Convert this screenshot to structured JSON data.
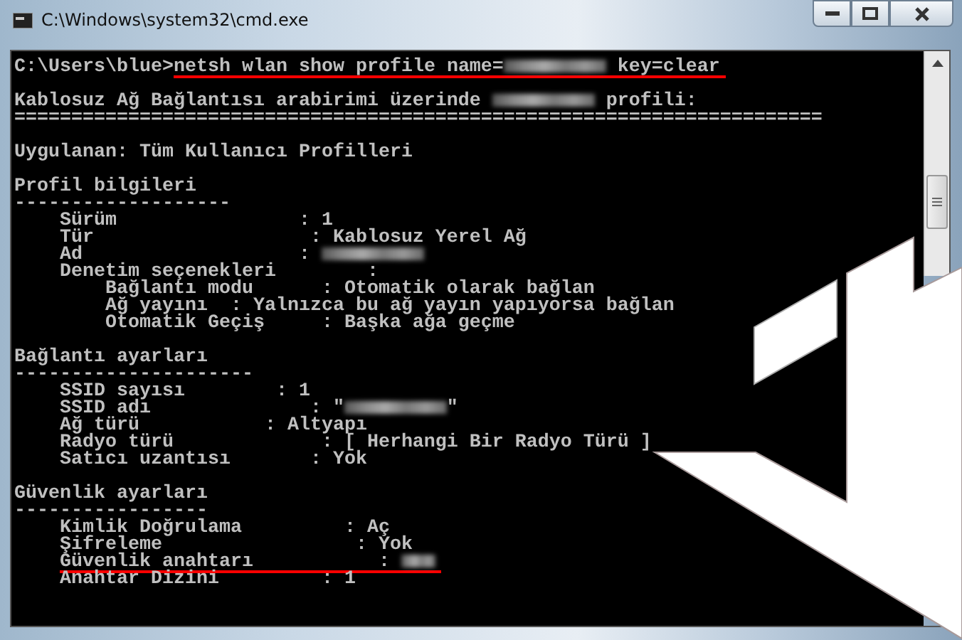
{
  "window": {
    "title": "C:\\Windows\\system32\\cmd.exe"
  },
  "console": {
    "lines": [
      {
        "kind": "text",
        "segments": [
          {
            "text": "C:\\Users\\blue>"
          }
        ],
        "marked": [
          {
            "text": "netsh wlan show profile name="
          },
          {
            "kind": "redacted"
          },
          {
            "text": " key=clear"
          }
        ]
      },
      {
        "kind": "blank"
      },
      {
        "kind": "text",
        "segments": [
          {
            "text": "Kablosuz Ağ Bağlantısı arabirimi üzerinde "
          },
          {
            "kind": "redacted"
          },
          {
            "text": " profili:"
          }
        ]
      },
      {
        "kind": "text",
        "segments": [
          {
            "text": "======================================================================="
          }
        ]
      },
      {
        "kind": "blank"
      },
      {
        "kind": "text",
        "segments": [
          {
            "text": "Uygulanan: Tüm Kullanıcı Profilleri"
          }
        ]
      },
      {
        "kind": "blank"
      },
      {
        "kind": "text",
        "segments": [
          {
            "text": "Profil bilgileri"
          }
        ]
      },
      {
        "kind": "text",
        "segments": [
          {
            "text": "-------------------"
          }
        ]
      },
      {
        "kind": "text",
        "segments": [
          {
            "text": "    Sürüm                : 1"
          }
        ]
      },
      {
        "kind": "text",
        "segments": [
          {
            "text": "    Tür                   : Kablosuz Yerel Ağ"
          }
        ]
      },
      {
        "kind": "text",
        "segments": [
          {
            "text": "    Ad                   : "
          },
          {
            "kind": "redacted"
          }
        ]
      },
      {
        "kind": "text",
        "segments": [
          {
            "text": "    Denetim seçenekleri        :"
          }
        ]
      },
      {
        "kind": "text",
        "segments": [
          {
            "text": "        Bağlantı modu      : Otomatik olarak bağlan"
          }
        ]
      },
      {
        "kind": "text",
        "segments": [
          {
            "text": "        Ağ yayını  : Yalnızca bu ağ yayın yapıyorsa bağlan"
          }
        ]
      },
      {
        "kind": "text",
        "segments": [
          {
            "text": "        Otomatik Geçiş     : Başka ağa geçme"
          }
        ]
      },
      {
        "kind": "blank"
      },
      {
        "kind": "text",
        "segments": [
          {
            "text": "Bağlantı ayarları"
          }
        ]
      },
      {
        "kind": "text",
        "segments": [
          {
            "text": "---------------------"
          }
        ]
      },
      {
        "kind": "text",
        "segments": [
          {
            "text": "    SSID sayısı        : 1"
          }
        ]
      },
      {
        "kind": "text",
        "segments": [
          {
            "text": "    SSID adı              : \""
          },
          {
            "kind": "redacted"
          },
          {
            "text": "\""
          }
        ]
      },
      {
        "kind": "text",
        "segments": [
          {
            "text": "    Ağ türü           : Altyapı"
          }
        ]
      },
      {
        "kind": "text",
        "segments": [
          {
            "text": "    Radyo türü             : [ Herhangi Bir Radyo Türü ]"
          }
        ]
      },
      {
        "kind": "text",
        "segments": [
          {
            "text": "    Satıcı uzantısı       : Yok"
          }
        ]
      },
      {
        "kind": "blank"
      },
      {
        "kind": "text",
        "segments": [
          {
            "text": "Güvenlik ayarları"
          }
        ]
      },
      {
        "kind": "text",
        "segments": [
          {
            "text": "-----------------"
          }
        ]
      },
      {
        "kind": "text",
        "segments": [
          {
            "text": "    Kimlik Doğrulama         : Aç"
          }
        ]
      },
      {
        "kind": "text",
        "segments": [
          {
            "text": "    Şifreleme                 : Yok"
          }
        ]
      },
      {
        "kind": "text",
        "marked": [
          {
            "text": "    Güvenlik anahtarı           : "
          },
          {
            "kind": "redacted_short"
          }
        ]
      },
      {
        "kind": "text",
        "segments": [
          {
            "text": "    Anahtar Dizini         : 1"
          }
        ]
      }
    ]
  }
}
